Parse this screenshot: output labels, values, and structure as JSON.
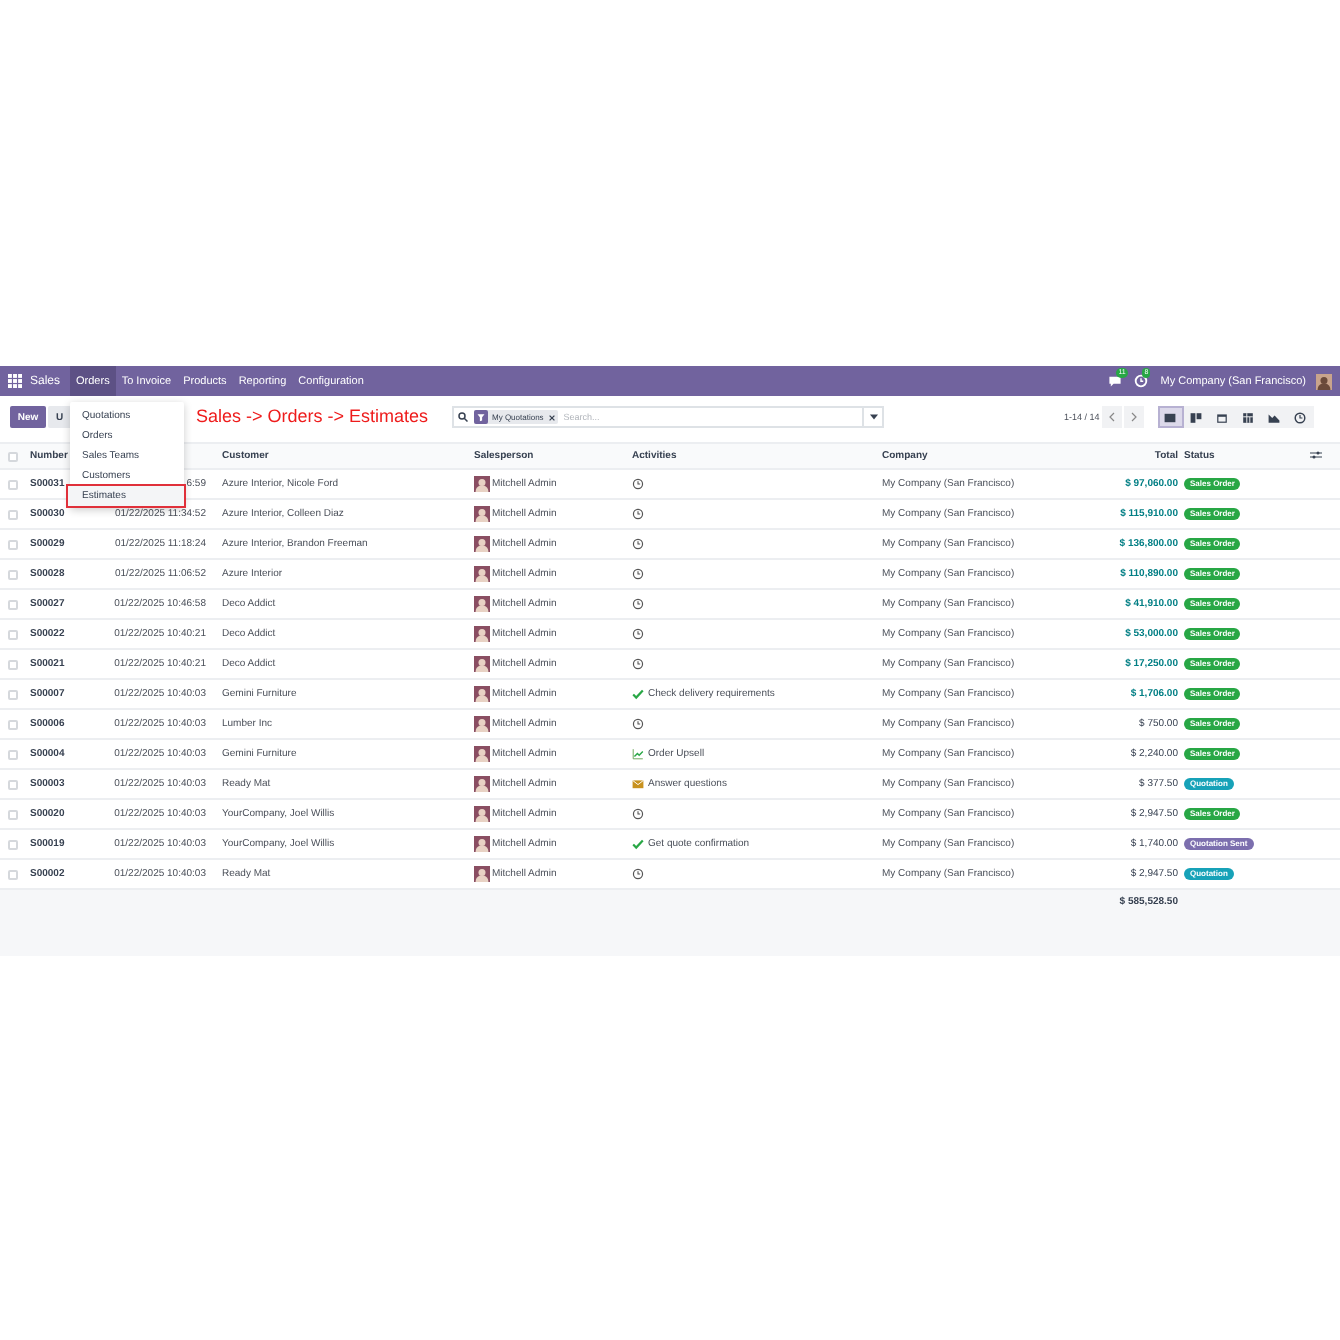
{
  "navbar": {
    "app": "Sales",
    "menus": [
      {
        "label": "Orders",
        "selected": true
      },
      {
        "label": "To Invoice",
        "selected": false
      },
      {
        "label": "Products",
        "selected": false
      },
      {
        "label": "Reporting",
        "selected": false
      },
      {
        "label": "Configuration",
        "selected": false
      }
    ],
    "chat_badge": "11",
    "activity_badge": "8",
    "company": "My Company (San Francisco)"
  },
  "toolbar": {
    "new_button": "New",
    "upload_button": "U",
    "search": {
      "facet": "My Quotations",
      "placeholder": "Search..."
    },
    "pager": "1-14 / 14",
    "views": [
      {
        "kind": "list",
        "selected": true
      },
      {
        "kind": "kanban",
        "selected": false
      },
      {
        "kind": "calendar",
        "selected": false
      },
      {
        "kind": "pivot",
        "selected": false
      },
      {
        "kind": "graph",
        "selected": false
      },
      {
        "kind": "activity",
        "selected": false
      }
    ]
  },
  "dropdown": {
    "items": [
      {
        "label": "Quotations",
        "annotated": false
      },
      {
        "label": "Orders",
        "annotated": false
      },
      {
        "label": "Sales Teams",
        "annotated": false
      },
      {
        "label": "Customers",
        "annotated": false
      },
      {
        "label": "Estimates",
        "annotated": true
      }
    ]
  },
  "annotation": "Sales -> Orders -> Estimates",
  "table": {
    "select_all_checked": false,
    "columns": [
      "Number",
      "Customer",
      "Salesperson",
      "Activities",
      "Company",
      "Total",
      "Status"
    ],
    "rows": [
      {
        "checked": false,
        "number": "S00031",
        "date": "6:59",
        "customer": "Azure Interior, Nicole Ford",
        "salesperson": "Mitchell Admin",
        "activity": {
          "kind": "clock"
        },
        "company": "My Company (San Francisco)",
        "total": "$ 97,060.00",
        "total_highlight": true,
        "status": {
          "label": "Sales Order",
          "kind": "sales_order"
        }
      },
      {
        "checked": false,
        "number": "S00030",
        "date": "01/22/2025 11:34:52",
        "customer": "Azure Interior, Colleen Diaz",
        "salesperson": "Mitchell Admin",
        "activity": {
          "kind": "clock"
        },
        "company": "My Company (San Francisco)",
        "total": "$ 115,910.00",
        "total_highlight": true,
        "status": {
          "label": "Sales Order",
          "kind": "sales_order"
        }
      },
      {
        "checked": false,
        "number": "S00029",
        "date": "01/22/2025 11:18:24",
        "customer": "Azure Interior, Brandon Freeman",
        "salesperson": "Mitchell Admin",
        "activity": {
          "kind": "clock"
        },
        "company": "My Company (San Francisco)",
        "total": "$ 136,800.00",
        "total_highlight": true,
        "status": {
          "label": "Sales Order",
          "kind": "sales_order"
        }
      },
      {
        "checked": false,
        "number": "S00028",
        "date": "01/22/2025 11:06:52",
        "customer": "Azure Interior",
        "salesperson": "Mitchell Admin",
        "activity": {
          "kind": "clock"
        },
        "company": "My Company (San Francisco)",
        "total": "$ 110,890.00",
        "total_highlight": true,
        "status": {
          "label": "Sales Order",
          "kind": "sales_order"
        }
      },
      {
        "checked": false,
        "number": "S00027",
        "date": "01/22/2025 10:46:58",
        "customer": "Deco Addict",
        "salesperson": "Mitchell Admin",
        "activity": {
          "kind": "clock"
        },
        "company": "My Company (San Francisco)",
        "total": "$ 41,910.00",
        "total_highlight": true,
        "status": {
          "label": "Sales Order",
          "kind": "sales_order"
        }
      },
      {
        "checked": false,
        "number": "S00022",
        "date": "01/22/2025 10:40:21",
        "customer": "Deco Addict",
        "salesperson": "Mitchell Admin",
        "activity": {
          "kind": "clock"
        },
        "company": "My Company (San Francisco)",
        "total": "$ 53,000.00",
        "total_highlight": true,
        "status": {
          "label": "Sales Order",
          "kind": "sales_order"
        }
      },
      {
        "checked": false,
        "number": "S00021",
        "date": "01/22/2025 10:40:21",
        "customer": "Deco Addict",
        "salesperson": "Mitchell Admin",
        "activity": {
          "kind": "clock"
        },
        "company": "My Company (San Francisco)",
        "total": "$ 17,250.00",
        "total_highlight": true,
        "status": {
          "label": "Sales Order",
          "kind": "sales_order"
        }
      },
      {
        "checked": false,
        "number": "S00007",
        "date": "01/22/2025 10:40:03",
        "customer": "Gemini Furniture",
        "salesperson": "Mitchell Admin",
        "activity": {
          "kind": "check",
          "text": "Check delivery requirements"
        },
        "company": "My Company (San Francisco)",
        "total": "$ 1,706.00",
        "total_highlight": true,
        "status": {
          "label": "Sales Order",
          "kind": "sales_order"
        }
      },
      {
        "checked": false,
        "number": "S00006",
        "date": "01/22/2025 10:40:03",
        "customer": "Lumber Inc",
        "salesperson": "Mitchell Admin",
        "activity": {
          "kind": "clock"
        },
        "company": "My Company (San Francisco)",
        "total": "$ 750.00",
        "total_highlight": false,
        "status": {
          "label": "Sales Order",
          "kind": "sales_order"
        }
      },
      {
        "checked": false,
        "number": "S00004",
        "date": "01/22/2025 10:40:03",
        "customer": "Gemini Furniture",
        "salesperson": "Mitchell Admin",
        "activity": {
          "kind": "chart",
          "text": "Order Upsell"
        },
        "company": "My Company (San Francisco)",
        "total": "$ 2,240.00",
        "total_highlight": false,
        "status": {
          "label": "Sales Order",
          "kind": "sales_order"
        }
      },
      {
        "checked": false,
        "number": "S00003",
        "date": "01/22/2025 10:40:03",
        "customer": "Ready Mat",
        "salesperson": "Mitchell Admin",
        "activity": {
          "kind": "mail",
          "text": "Answer questions"
        },
        "company": "My Company (San Francisco)",
        "total": "$ 377.50",
        "total_highlight": false,
        "status": {
          "label": "Quotation",
          "kind": "quotation"
        }
      },
      {
        "checked": false,
        "number": "S00020",
        "date": "01/22/2025 10:40:03",
        "customer": "YourCompany, Joel Willis",
        "salesperson": "Mitchell Admin",
        "activity": {
          "kind": "clock"
        },
        "company": "My Company (San Francisco)",
        "total": "$ 2,947.50",
        "total_highlight": false,
        "status": {
          "label": "Sales Order",
          "kind": "sales_order"
        }
      },
      {
        "checked": false,
        "number": "S00019",
        "date": "01/22/2025 10:40:03",
        "customer": "YourCompany, Joel Willis",
        "salesperson": "Mitchell Admin",
        "activity": {
          "kind": "check",
          "text": "Get quote confirmation"
        },
        "company": "My Company (San Francisco)",
        "total": "$ 1,740.00",
        "total_highlight": false,
        "status": {
          "label": "Quotation Sent",
          "kind": "quotation_sent"
        }
      },
      {
        "checked": false,
        "number": "S00002",
        "date": "01/22/2025 10:40:03",
        "customer": "Ready Mat",
        "salesperson": "Mitchell Admin",
        "activity": {
          "kind": "clock"
        },
        "company": "My Company (San Francisco)",
        "total": "$ 2,947.50",
        "total_highlight": false,
        "status": {
          "label": "Quotation",
          "kind": "quotation"
        }
      }
    ],
    "grand_total": "$ 585,528.50"
  }
}
